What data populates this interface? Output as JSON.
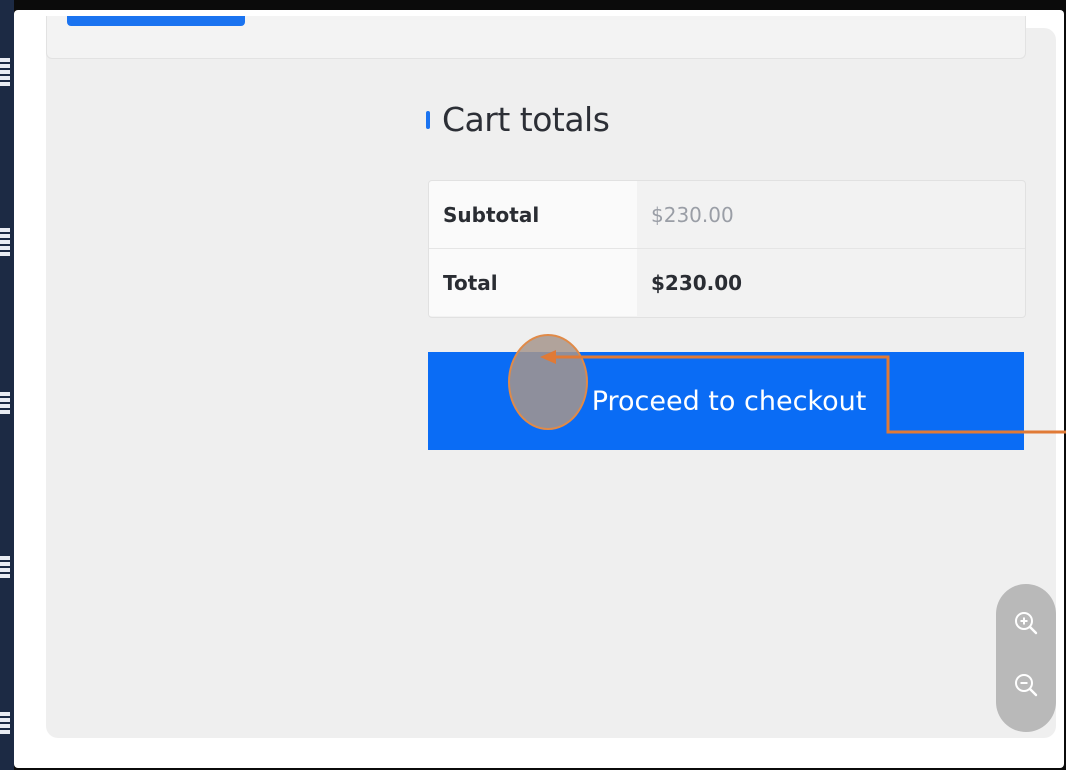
{
  "cart_totals": {
    "heading": "Cart totals",
    "rows": [
      {
        "label": "Subtotal",
        "value": "$230.00"
      },
      {
        "label": "Total",
        "value": "$230.00"
      }
    ],
    "checkout_label": "Proceed to checkout"
  },
  "zoom": {
    "in_icon": "zoom-in-icon",
    "out_icon": "zoom-out-icon"
  },
  "colors": {
    "accent": "#0a6cf5",
    "annotation": "#e07a36"
  }
}
